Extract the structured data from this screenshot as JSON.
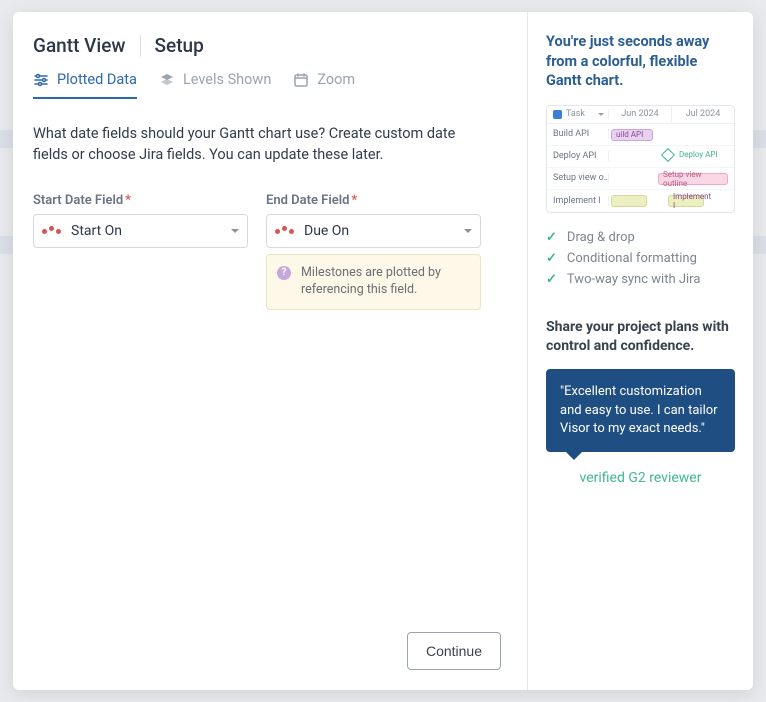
{
  "breadcrumb": {
    "item1": "Gantt View",
    "item2": "Setup"
  },
  "tabs": {
    "plotted_data": "Plotted Data",
    "levels_shown": "Levels Shown",
    "zoom": "Zoom"
  },
  "prompt": "What date fields should your Gantt chart use? Create custom date fields or choose Jira fields. You can update these later.",
  "fields": {
    "start": {
      "label": "Start Date Field",
      "value": "Start On"
    },
    "end": {
      "label": "End Date Field",
      "value": "Due On",
      "hint": "Milestones are plotted by referencing this field."
    }
  },
  "continue_label": "Continue",
  "right": {
    "title": "You're just seconds away from a colorful, flexible Gantt chart.",
    "preview": {
      "task_header": "Task",
      "col1": "Jun 2024",
      "col2": "Jul 2024",
      "rows": {
        "r1": "Build API",
        "r2": "Deploy API",
        "r3": "Setup view o…",
        "r4": "Implement I",
        "bar_build": "uild API",
        "bar_deploy": "Deploy API",
        "bar_setup": "Setup view outline",
        "bar_imp": "Implement I"
      }
    },
    "features": {
      "f1": "Drag & drop",
      "f2": "Conditional formatting",
      "f3": "Two-way sync with Jira"
    },
    "subtitle": "Share your project plans with control and confidence.",
    "quote": "\"Excellent customization and easy to use. I can tailor Visor to my exact needs.\"",
    "reviewer": "verified G2 reviewer"
  }
}
